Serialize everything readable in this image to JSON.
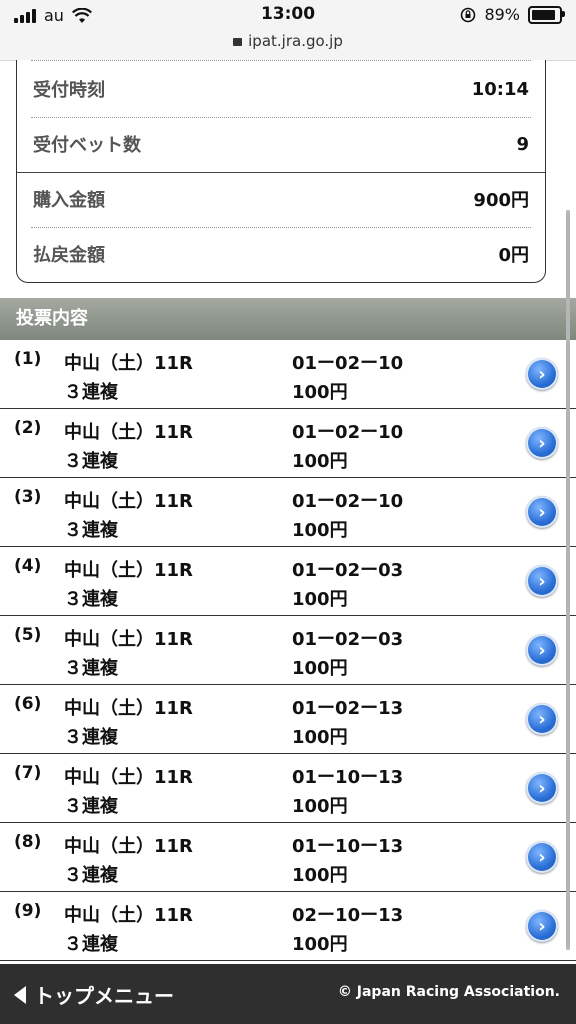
{
  "status_bar": {
    "carrier": "au",
    "time": "13:00",
    "battery": "89%",
    "battery_level": 0.89,
    "url": "ipat.jra.go.jp"
  },
  "summary": {
    "rows": [
      {
        "label": "受付時刻",
        "value": "10:14"
      },
      {
        "label": "受付ベット数",
        "value": "9"
      },
      {
        "label": "購入金額",
        "value": "900円"
      },
      {
        "label": "払戻金額",
        "value": "0円"
      }
    ]
  },
  "section_title": "投票内容",
  "bets": [
    {
      "no": "(1)",
      "course": "中山（土）11R",
      "type": "３連複",
      "combo": "01ー02ー10",
      "amount": "100円"
    },
    {
      "no": "(2)",
      "course": "中山（土）11R",
      "type": "３連複",
      "combo": "01ー02ー10",
      "amount": "100円"
    },
    {
      "no": "(3)",
      "course": "中山（土）11R",
      "type": "３連複",
      "combo": "01ー02ー10",
      "amount": "100円"
    },
    {
      "no": "(4)",
      "course": "中山（土）11R",
      "type": "３連複",
      "combo": "01ー02ー03",
      "amount": "100円"
    },
    {
      "no": "(5)",
      "course": "中山（土）11R",
      "type": "３連複",
      "combo": "01ー02ー03",
      "amount": "100円"
    },
    {
      "no": "(6)",
      "course": "中山（土）11R",
      "type": "３連複",
      "combo": "01ー02ー13",
      "amount": "100円"
    },
    {
      "no": "(7)",
      "course": "中山（土）11R",
      "type": "３連複",
      "combo": "01ー10ー13",
      "amount": "100円"
    },
    {
      "no": "(8)",
      "course": "中山（土）11R",
      "type": "３連複",
      "combo": "01ー10ー13",
      "amount": "100円"
    },
    {
      "no": "(9)",
      "course": "中山（土）11R",
      "type": "３連複",
      "combo": "02ー10ー13",
      "amount": "100円"
    }
  ],
  "footer": {
    "back_label": "トップメニュー",
    "copyright": "© Japan Racing Association."
  }
}
